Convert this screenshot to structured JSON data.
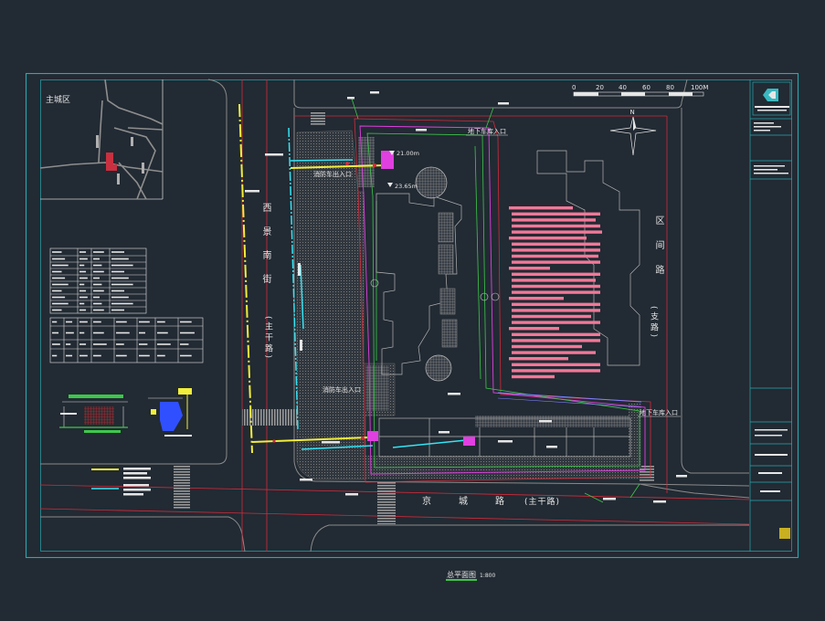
{
  "inset_map": {
    "label": "主城区"
  },
  "scale_bar": {
    "labels": [
      "0",
      "20",
      "40",
      "60",
      "80",
      "100M"
    ]
  },
  "north_arrow": {
    "label": "N"
  },
  "roads": {
    "west": {
      "name": "西景南街",
      "class": "(主干路)"
    },
    "east": {
      "name": "区间路",
      "class": "(支路)"
    },
    "south": {
      "name": "京城路",
      "class": "(主干路)"
    }
  },
  "site_labels": {
    "garage_entry_north": "地下车库入口",
    "garage_entry_east": "地下车库入口",
    "fire_entry_north": "消防车出入口",
    "fire_entry_south": "消防车出入口",
    "elevation_1": "21.00m",
    "elevation_2": "23.65m"
  },
  "drawing_title": {
    "name": "总平面图",
    "scale": "1:800"
  },
  "palette": {
    "background": "#222a33",
    "frame": "#2aa8b0",
    "road": "#8a8a8a",
    "red": "#d42a3a",
    "magenta": "#e040e0",
    "green": "#3cc84a",
    "yellow": "#f2ee3a",
    "cyan": "#34e4f4",
    "pink_notes": "#f27898",
    "building": "#b4b4b4",
    "text": "#e6e6e6"
  }
}
